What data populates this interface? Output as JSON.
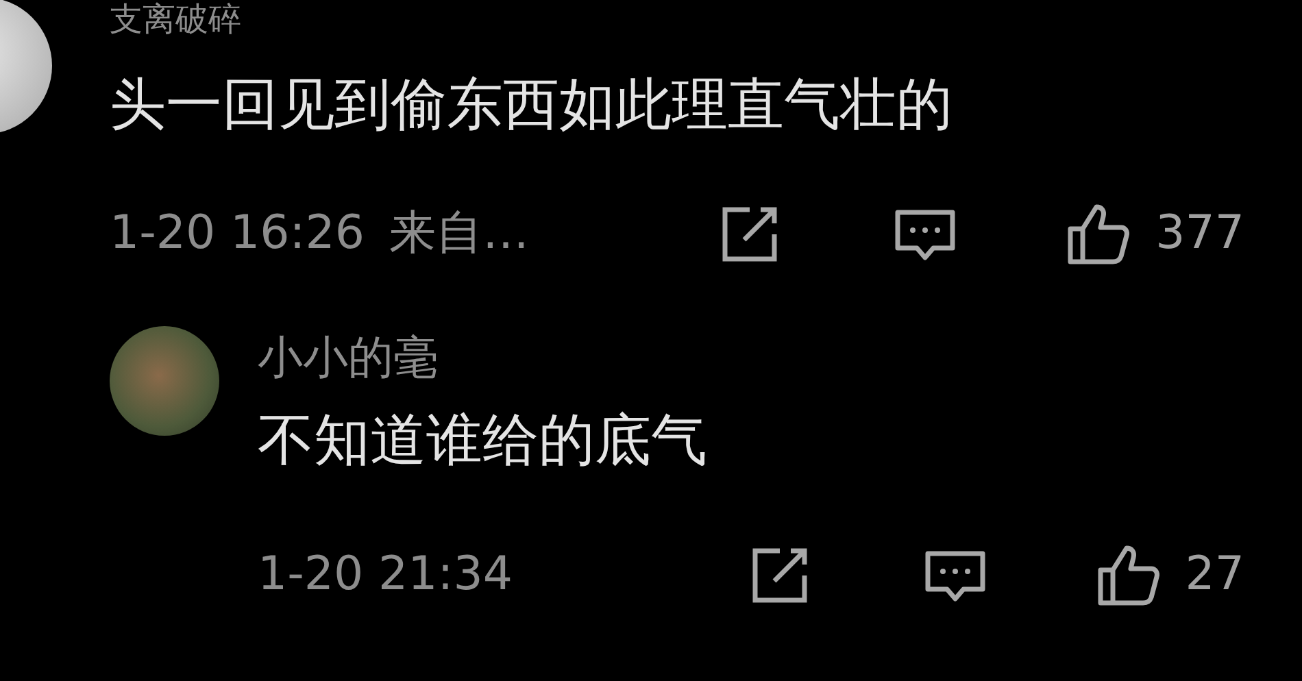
{
  "comments": [
    {
      "username": "支离破碎",
      "text": "头一回见到偷东西如此理直气壮的",
      "time": "1-20 16:26",
      "source": "来自…",
      "likes": "377",
      "replies": [
        {
          "username": "小小的毫",
          "text": "不知道谁给的底气",
          "time": "1-20 21:34",
          "likes": "27"
        }
      ]
    }
  ]
}
